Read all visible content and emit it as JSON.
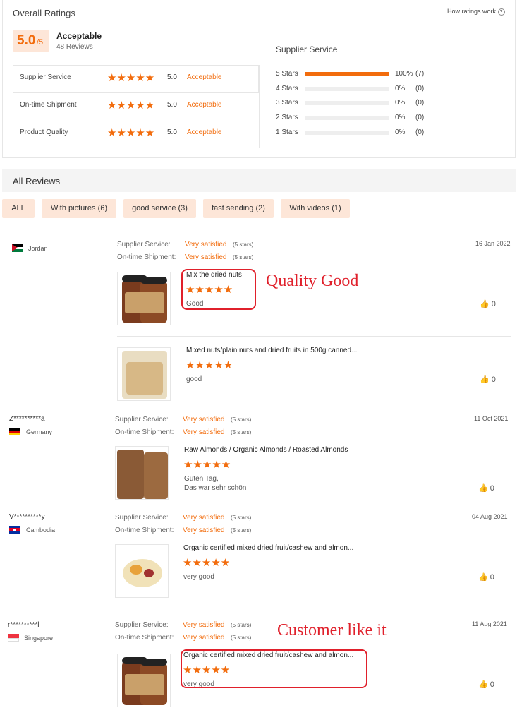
{
  "overall": {
    "title": "Overall Ratings",
    "how_link": "How ratings work",
    "score": "5.0",
    "score_suffix": "/5",
    "verdict": "Acceptable",
    "review_count": "48 Reviews",
    "metrics": [
      {
        "label": "Supplier Service",
        "rating": 5,
        "value": "5.0",
        "verdict": "Acceptable"
      },
      {
        "label": "On-time Shipment",
        "rating": 5,
        "value": "5.0",
        "verdict": "Acceptable"
      },
      {
        "label": "Product Quality",
        "rating": 5,
        "value": "5.0",
        "verdict": "Acceptable"
      }
    ],
    "breakdown_title": "Supplier Service",
    "breakdown": [
      {
        "label": "5 Stars",
        "fraction": 1.0,
        "percent": "100%",
        "count": "(7)"
      },
      {
        "label": "4 Stars",
        "fraction": 0,
        "percent": "0%",
        "count": "(0)"
      },
      {
        "label": "3 Stars",
        "fraction": 0,
        "percent": "0%",
        "count": "(0)"
      },
      {
        "label": "2 Stars",
        "fraction": 0,
        "percent": "0%",
        "count": "(0)"
      },
      {
        "label": "1 Stars",
        "fraction": 0,
        "percent": "0%",
        "count": "(0)"
      }
    ]
  },
  "reviews_header": "All Reviews",
  "filters": [
    "ALL",
    "With pictures (6)",
    "good service (3)",
    "fast sending (2)",
    "With videos (1)"
  ],
  "labels": {
    "supplier_service": "Supplier Service:",
    "on_time": "On-time Shipment:",
    "very_satisfied": "Very satisfied",
    "five_stars": "(5 stars)"
  },
  "reviews": [
    {
      "user": "",
      "country": "Jordan",
      "date": "16 Jan 2022",
      "products": [
        {
          "title": "Mix the dried nuts",
          "rating": 5,
          "comment": "Good",
          "likes": "0"
        },
        {
          "title": "Mixed nuts/plain nuts and dried fruits in 500g canned...",
          "rating": 5,
          "comment": "good",
          "likes": "0"
        }
      ]
    },
    {
      "user": "Z**********a",
      "country": "Germany",
      "date": "11 Oct 2021",
      "products": [
        {
          "title": "Raw Almonds / Organic Almonds / Roasted Almonds",
          "rating": 5,
          "comment": "Guten Tag,",
          "comment2": "Das war sehr schön",
          "likes": "0"
        }
      ]
    },
    {
      "user": "V**********y",
      "country": "Cambodia",
      "date": "04 Aug 2021",
      "products": [
        {
          "title": "Organic certified mixed dried fruit/cashew and almon...",
          "rating": 5,
          "comment": "very good",
          "likes": "0"
        }
      ]
    },
    {
      "user": "r**********l",
      "country": "Singapore",
      "date": "11 Aug 2021",
      "products": [
        {
          "title": "Organic certified mixed dried fruit/cashew and almon...",
          "rating": 5,
          "comment": "very good",
          "likes": "0"
        }
      ]
    }
  ],
  "annotations": [
    "Quality Good",
    "Customer like it"
  ],
  "colors": {
    "accent": "#f26c0d",
    "annotation": "#e0202b",
    "chip_bg": "#fde6d8"
  }
}
